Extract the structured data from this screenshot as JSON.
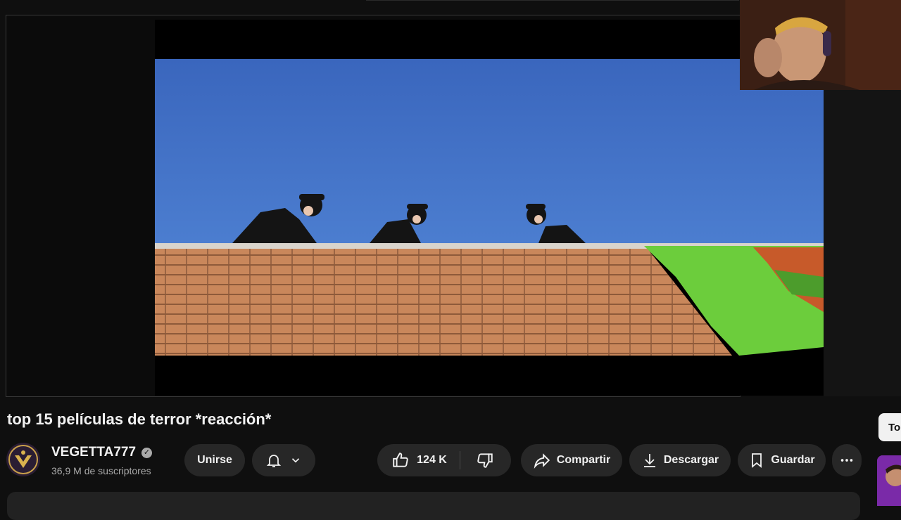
{
  "video": {
    "title": "top 15 películas de terror *reacción*"
  },
  "channel": {
    "name": "VEGETTA777",
    "subscribers": "36,9 M de suscriptores"
  },
  "actions": {
    "join_label": "Unirse",
    "like_count": "124 K",
    "share_label": "Compartir",
    "download_label": "Descargar",
    "save_label": "Guardar"
  },
  "side": {
    "chip_label": "To"
  },
  "icons": {
    "verified": "verified-check-icon",
    "bell": "bell-icon",
    "chevron": "chevron-down-icon",
    "like": "thumbs-up-icon",
    "dislike": "thumbs-down-icon",
    "share": "share-arrow-icon",
    "download": "download-icon",
    "save": "bookmark-icon",
    "more": "more-horizontal-icon"
  },
  "colors": {
    "background": "#0f0f0f",
    "pill": "#272727",
    "sky": "#3f6fc4",
    "brick": "#c8855a",
    "tarp": "#6fcf3f"
  }
}
